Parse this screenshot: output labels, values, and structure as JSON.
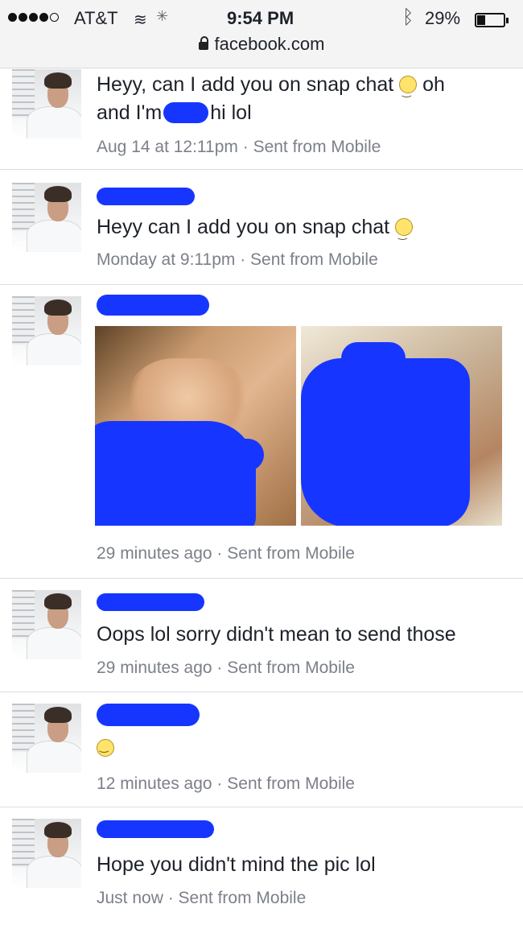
{
  "status_bar": {
    "carrier": "AT&T",
    "time": "9:54 PM",
    "battery": "29%",
    "url": "facebook.com",
    "signal_icons": [
      "signal-dots-icon",
      "wifi-icon",
      "activity-spinner-icon",
      "bluetooth-icon",
      "battery-icon"
    ]
  },
  "messages": [
    {
      "text_line1": "Heyy, can I add you on snap chat",
      "text_line1_tail": "oh",
      "text_line2_start": "and I'm",
      "text_line2_end": "hi lol",
      "meta": "Aug 14 at 12:11pm · Sent from Mobile"
    },
    {
      "text": "Heyy can I add you on snap chat",
      "meta": "Monday at 9:11pm · Sent from Mobile"
    },
    {
      "meta": "29 minutes ago · Sent from Mobile"
    },
    {
      "text": "Oops lol sorry didn't mean to send those",
      "meta": "29 minutes ago · Sent from Mobile"
    },
    {
      "meta": "12 minutes ago · Sent from Mobile"
    },
    {
      "text": "Hope you didn't mind the pic lol",
      "meta": "Just now · Sent from Mobile"
    }
  ],
  "colors": {
    "censor_blue": "#1636ff",
    "meta_gray": "#7c8089",
    "text": "#1d2129"
  }
}
